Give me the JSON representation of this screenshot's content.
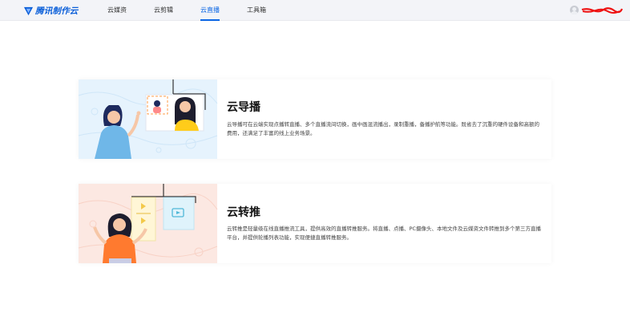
{
  "brand": {
    "name": "腾讯制作云"
  },
  "nav": {
    "items": [
      {
        "label": "云媒资",
        "active": false
      },
      {
        "label": "云剪辑",
        "active": false
      },
      {
        "label": "云直播",
        "active": true
      },
      {
        "label": "工具箱",
        "active": false
      }
    ]
  },
  "colors": {
    "accent": "#0b66e4",
    "logo": "#0b5fd9",
    "redaction": "#e11"
  },
  "cards": [
    {
      "title": "云导播",
      "description": "云导播可在云端实现点播转直播、多个直播流间切换，画中画混流播出，录制重播，备播护航等功能。既省去了沉重的硬件设备和高额的费用，还满足了丰富的线上业务场景。"
    },
    {
      "title": "云转推",
      "description": "云转推是轻量级在线直播推流工具，提供高效的直播转推服务。将直播、点播、PC摄像头、本地文件及云媒资文件转推到多个第三方直播平台，并提供轮播列表功能，实现便捷直播转推服务。"
    }
  ]
}
